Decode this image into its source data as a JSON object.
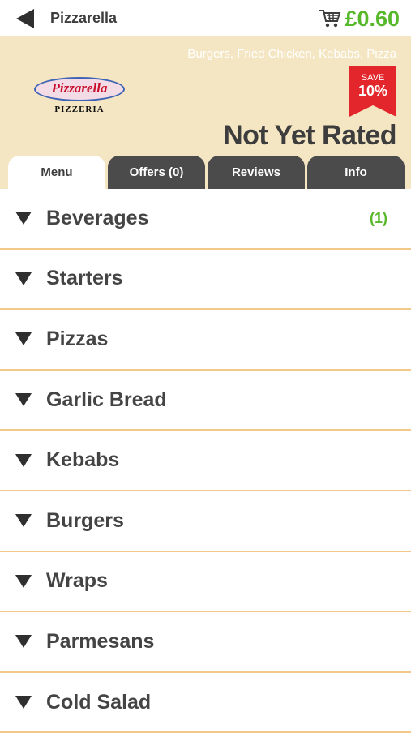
{
  "topbar": {
    "title": "Pizzarella",
    "cart_total": "£0.60",
    "icons": {
      "back": "back-arrow-icon",
      "cart": "shopping-cart-icon"
    }
  },
  "header": {
    "cuisines": "Burgers, Fried Chicken, Kebabs, Pizza",
    "logo": {
      "name": "Pizzarella",
      "subtitle": "PIZZERIA"
    },
    "save_badge": {
      "label": "SAVE",
      "percent": "10%"
    },
    "rating": "Not Yet Rated"
  },
  "tabs": [
    {
      "label": "Menu",
      "active": true
    },
    {
      "label": "Offers (0)",
      "active": false
    },
    {
      "label": "Reviews",
      "active": false
    },
    {
      "label": "Info",
      "active": false
    }
  ],
  "menu": [
    {
      "label": "Beverages",
      "count": "(1)"
    },
    {
      "label": "Starters",
      "count": ""
    },
    {
      "label": "Pizzas",
      "count": ""
    },
    {
      "label": "Garlic Bread",
      "count": ""
    },
    {
      "label": "Kebabs",
      "count": ""
    },
    {
      "label": "Burgers",
      "count": ""
    },
    {
      "label": "Wraps",
      "count": ""
    },
    {
      "label": "Parmesans",
      "count": ""
    },
    {
      "label": "Cold Salad",
      "count": ""
    }
  ],
  "colors": {
    "accent_green": "#56b82a",
    "header_bg": "#f5e6c3",
    "tab_dark": "#4b4b4b",
    "badge_red": "#e3262b",
    "divider": "#f3c98b"
  }
}
